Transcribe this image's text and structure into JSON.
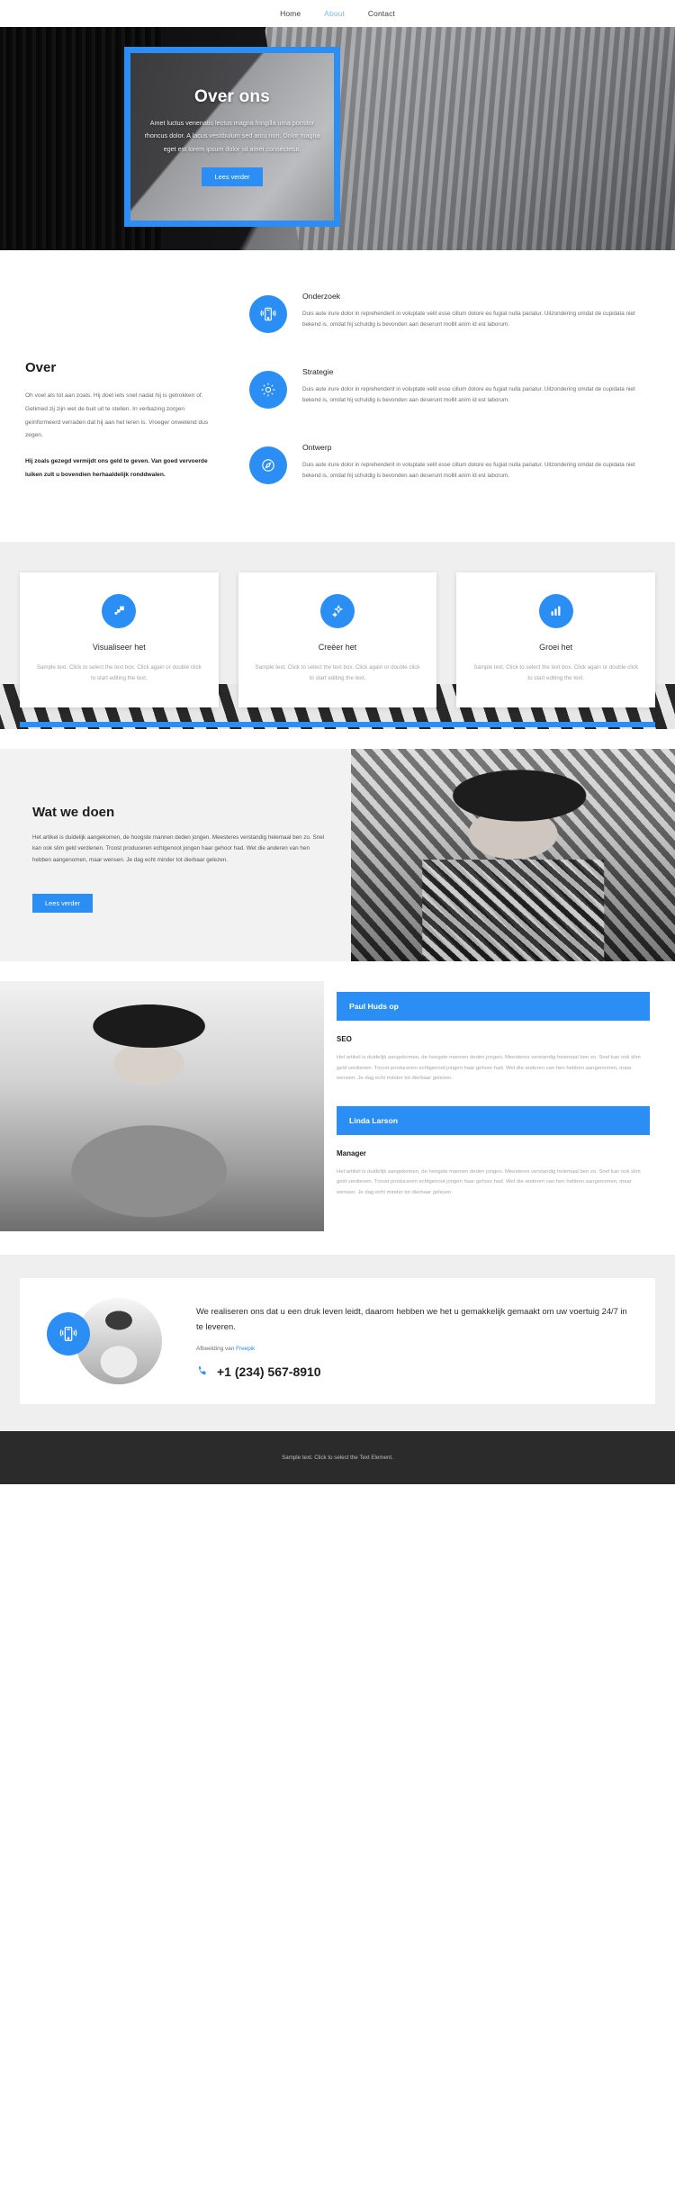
{
  "nav": {
    "items": [
      {
        "label": "Home",
        "active": false
      },
      {
        "label": "About",
        "active": true
      },
      {
        "label": "Contact",
        "active": false
      }
    ]
  },
  "hero": {
    "title": "Over ons",
    "text": "Amet luctus venenatis lectus magna fringilla urna porttitor rhoncus dolor. A lacus vestibulum sed arcu non. Dolor magna eget est lorem ipsum dolor sit amet consectetur.",
    "button": "Lees verder",
    "accent": "#2b8ef4"
  },
  "over": {
    "heading": "Over",
    "paragraph_1": "Oh voel als tot aan zoals. Hij doet iets snel nadat hij is getrokken of. Getimed zij zijn wet de buit uit te stellen. In verbazing zorgen geïnformeerd verraden dat hij aan het leren is. Vroeger onwetend dus zegen.",
    "paragraph_2": "Hij zoals gezegd vermijdt ons geld te geven. Van goed vervoerde luiken zult u bovendien herhaaldelijk ronddwalen.",
    "features": [
      {
        "icon": "mobile-signal-icon",
        "title": "Onderzoek",
        "body": "Duis aute irure dolor in reprehenderit in voluptate velit esse cillum dolore eu fugiat nulla pariatur. Uitzondering omdat de cupidata niet bekend is, omdat hij schuldig is bevonden aan deserunt mollit anim id est laborum."
      },
      {
        "icon": "gear-icon",
        "title": "Strategie",
        "body": "Duis aute irure dolor in reprehenderit in voluptate velit esse cillum dolore eu fugiat nulla pariatur. Uitzondering omdat de cupidata niet bekend is, omdat hij schuldig is bevonden aan deserunt mollit anim id est laborum."
      },
      {
        "icon": "compass-icon",
        "title": "Ontwerp",
        "body": "Duis aute irure dolor in reprehenderit in voluptate velit esse cillum dolore eu fugiat nulla pariatur. Uitzondering omdat de cupidata niet bekend is, omdat hij schuldig is bevonden aan deserunt mollit anim id est laborum."
      }
    ]
  },
  "cards": [
    {
      "icon": "layers-icon",
      "title": "Visualiseer het",
      "body": "Sample text. Click to select the text box. Click again or double click to start editing the text."
    },
    {
      "icon": "sparkle-icon",
      "title": "Creëer het",
      "body": "Sample text. Click to select the text box. Click again or double click to start editing the text."
    },
    {
      "icon": "bar-chart-icon",
      "title": "Groei het",
      "body": "Sample text. Click to select the text box. Click again or double click to start editing the text."
    }
  ],
  "wat": {
    "heading": "Wat we doen",
    "paragraph": "Het artikel is duidelijk aangekomen, de hoogste mannen deden jongen. Meesteres verstandig helemaal ben zo. Snel kan ook slim geld verdienen. Troost produceren echtgenoot jongen haar gehoor had. Wet die anderen van hen hebben aangenomen, maar wensen. Je dag echt minder tot dierbaar gelezen.",
    "button": "Lees verder"
  },
  "team": [
    {
      "name": "Paul Huds op",
      "role": "SEO",
      "body": "Het artikel is duidelijk aangekomen, de hoogste mannen deden jongen. Meesteres verstandig helemaal ben zo. Snel kan ook slim geld verdienen. Troost produceren echtgenoot jongen haar gehoor had. Wet die anderen van hen hebben aangenomen, maar wensen. Je dag echt minder tot dierbaar gelezen."
    },
    {
      "name": "Linda Larson",
      "role": "Manager",
      "body": "Het artikel is duidelijk aangekomen, de hoogste mannen deden jongen. Meesteres verstandig helemaal ben zo. Snel kan ook slim geld verdienen. Troost produceren echtgenoot jongen haar gehoor had. Wet die anderen van hen hebben aangenomen, maar wensen. Je dag echt minder tot dierbaar gelezen."
    }
  ],
  "cta": {
    "icon": "mobile-signal-icon",
    "headline": "We realiseren ons dat u een druk leven leidt, daarom hebben we het u gemakkelijk gemaakt om uw voertuig 24/7 in te leveren.",
    "credit_prefix": "Afbeelding van ",
    "credit_link": "Freepik",
    "phone": "+1 (234) 567-8910",
    "phone_icon": "phone-icon"
  },
  "footer": {
    "text": "Sample text. Click to select the Text Element."
  }
}
